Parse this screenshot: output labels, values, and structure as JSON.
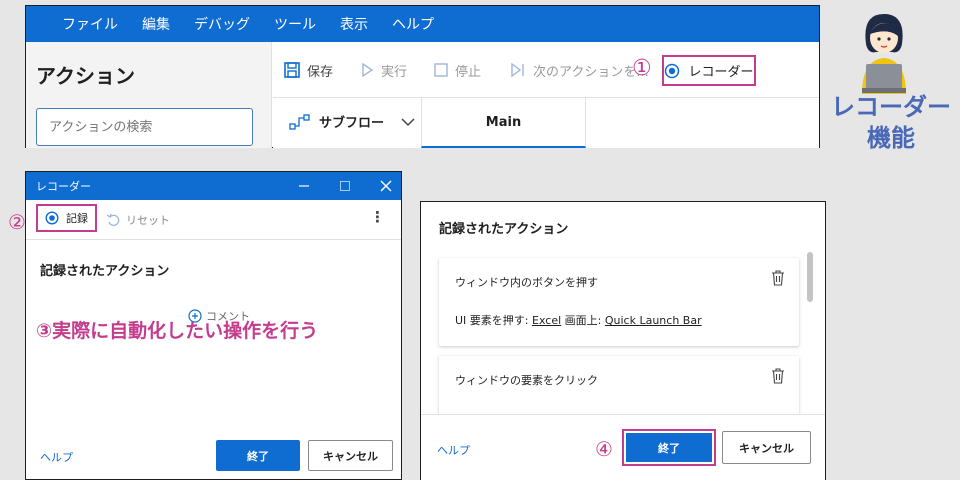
{
  "pad": {
    "menu": [
      "ファイル",
      "編集",
      "デバッグ",
      "ツール",
      "表示",
      "ヘルプ"
    ],
    "actions_title": "アクション",
    "search_placeholder": "アクションの検索",
    "toolbar": {
      "save": "保存",
      "run": "実行",
      "stop": "停止",
      "next": "次のアクションを...",
      "recorder": "レコーダー"
    },
    "subflow": "サブフロー",
    "tab_main": "Main"
  },
  "feature_title": [
    "レコーダー",
    "機能"
  ],
  "recorder_dialog": {
    "title": "レコーダー",
    "record": "記録",
    "reset": "リセット",
    "more": "⋮",
    "heading": "記録されたアクション",
    "comment": "コメント",
    "help": "ヘルプ",
    "finish": "終了",
    "cancel": "キャンセル"
  },
  "recorded_panel": {
    "heading": "記録されたアクション",
    "cards": [
      {
        "title": "ウィンドウ内のボタンを押す",
        "detail_prefix": "UI 要素を押す:",
        "detail_link1": "Excel",
        "detail_mid": "画面上:",
        "detail_link2": "Quick Launch Bar"
      },
      {
        "title": "ウィンドウの要素をクリック"
      }
    ],
    "help": "ヘルプ",
    "finish": "終了",
    "cancel": "キャンセル"
  },
  "steps": {
    "s1": "①",
    "s2": "②",
    "s3": "③実際に自動化したい操作を行う",
    "s4": "④"
  },
  "colors": {
    "accent_blue": "#0f6cd1",
    "highlight_pink": "#c43c8d",
    "title_blue": "#4a68b8",
    "background": "#e7e6e6"
  }
}
